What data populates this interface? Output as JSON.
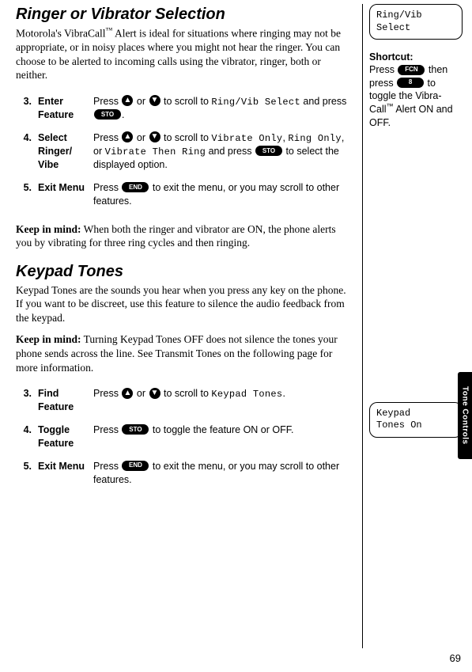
{
  "tab_label": "Tone Controls",
  "page_number": "69",
  "section1": {
    "heading": "Ringer or Vibrator Selection",
    "intro_pre": "Motorola's VibraCall",
    "intro_tm": "™",
    "intro_post": " Alert is ideal for situations where ringing may not be appropriate, or in noisy places where you might not hear the ringer. You can choose to be alerted to incoming calls using the vibrator, ringer, both or neither.",
    "steps": [
      {
        "num": "3.",
        "label": "Enter Feature",
        "pre": "Press ",
        "mid1": " or ",
        "mid2": " to scroll to ",
        "lcd": "Ring/Vib Select",
        "post1": " and press ",
        "post2": "."
      },
      {
        "num": "4.",
        "label": "Select Ringer/ Vibe",
        "pre": "Press ",
        "mid1": " or ",
        "mid2": " to scroll to ",
        "lcd1": "Vibrate Only",
        "comma1": ", ",
        "lcd2": "Ring Only",
        "comma2": ", or ",
        "lcd3": "Vibrate Then Ring",
        "post1": " and press ",
        "post2": " to select the displayed option."
      },
      {
        "num": "5.",
        "label": "Exit Menu",
        "pre": "Press ",
        "post": " to exit the menu, or you may scroll to other features."
      }
    ],
    "keep_label": "Keep in mind:",
    "keep_text": " When both the ringer and vibrator are ON, the phone alerts you by vibrating for three ring cycles and then ringing."
  },
  "section2": {
    "heading": "Keypad Tones",
    "intro": "Keypad Tones are the sounds you hear when you press any key on the phone. If you want to be discreet, use this feature to silence the audio feedback from the keypad.",
    "keep_label": "Keep in mind:",
    "keep_text": " Turning Keypad Tones OFF does not silence the tones your phone sends across the line. See Transmit Tones on the following page for more information.",
    "steps": [
      {
        "num": "3.",
        "label": "Find Feature",
        "pre": "Press ",
        "mid1": " or ",
        "mid2": " to scroll to ",
        "lcd": "Keypad Tones",
        "post": "."
      },
      {
        "num": "4.",
        "label": "Toggle Feature",
        "pre": "Press ",
        "post": " to toggle the feature ON or OFF."
      },
      {
        "num": "5.",
        "label": "Exit Menu",
        "pre": "Press ",
        "post": " to exit the menu, or you may scroll to other features."
      }
    ]
  },
  "sidebar": {
    "box1_line1": "Ring/Vib",
    "box1_line2": "Select",
    "shortcut_title": "Shortcut:",
    "shortcut_pre": "Press ",
    "shortcut_mid1": " then press ",
    "shortcut_mid2": " to toggle the Vibra-Call",
    "shortcut_tm": "™",
    "shortcut_post": " Alert ON and OFF.",
    "box2_line1": "Keypad",
    "box2_line2": "Tones On"
  },
  "keys": {
    "up": "▲",
    "down": "▼",
    "sto": "STO",
    "end": "END",
    "fcn": "FCN",
    "eight": "8"
  }
}
